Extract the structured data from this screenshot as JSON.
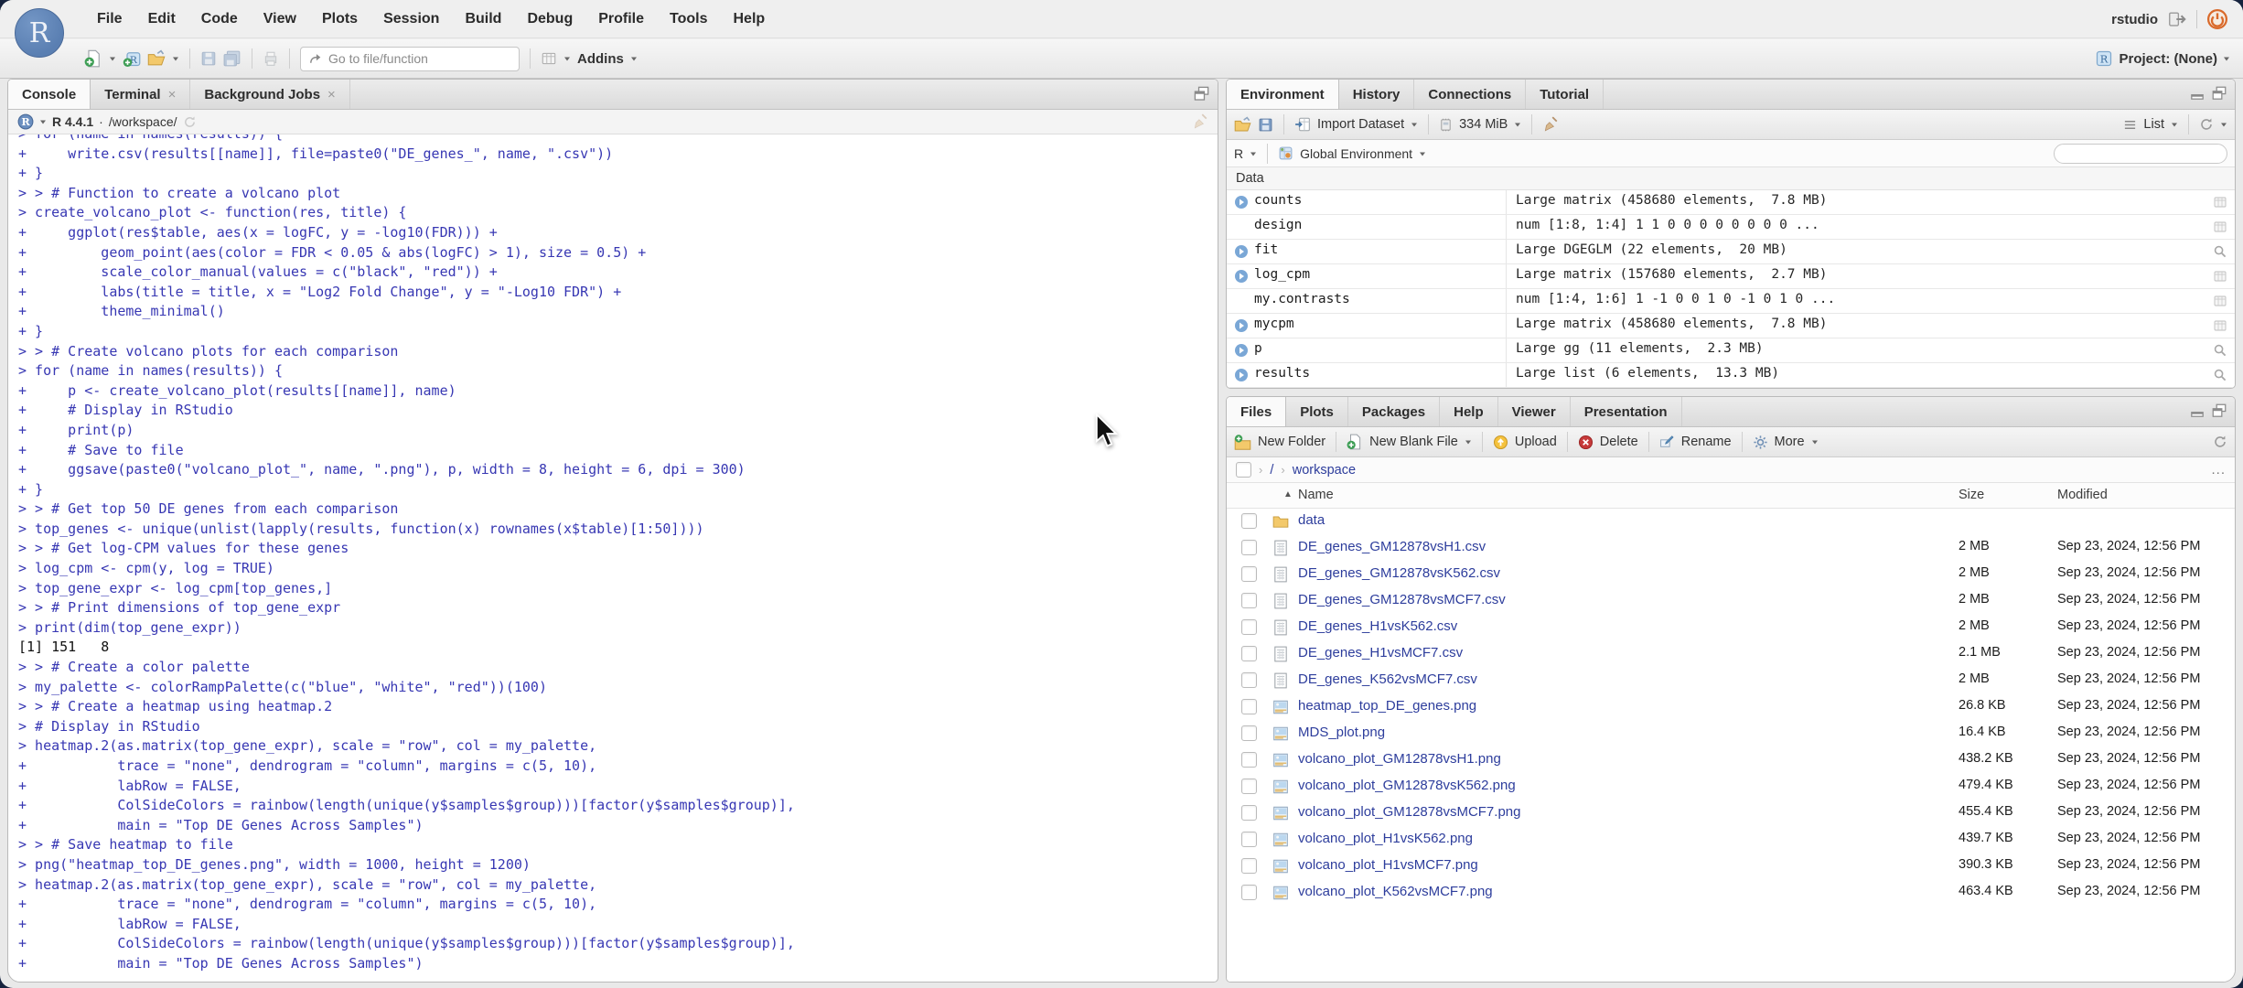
{
  "app": {
    "brand_letter": "R",
    "session_user": "rstudio",
    "project_label": "Project: (None)",
    "menu_items": [
      "File",
      "Edit",
      "Code",
      "View",
      "Plots",
      "Session",
      "Build",
      "Debug",
      "Profile",
      "Tools",
      "Help"
    ],
    "goto_placeholder": "Go to file/function",
    "addins_label": "Addins"
  },
  "console_pane": {
    "tabs": [
      {
        "label": "Console",
        "active": true,
        "closable": false
      },
      {
        "label": "Terminal",
        "active": false,
        "closable": true
      },
      {
        "label": "Background Jobs",
        "active": false,
        "closable": true
      }
    ],
    "r_version": "R 4.4.1",
    "dot": "·",
    "working_dir": "/workspace/",
    "lines": [
      {
        "kind": "input",
        "text": "> for (name in names(results)) {"
      },
      {
        "kind": "input",
        "text": "+     write.csv(results[[name]], file=paste0(\"DE_genes_\", name, \".csv\"))"
      },
      {
        "kind": "input",
        "text": "+ }"
      },
      {
        "kind": "input",
        "text": "> > # Function to create a volcano plot"
      },
      {
        "kind": "input",
        "text": "> create_volcano_plot <- function(res, title) {"
      },
      {
        "kind": "input",
        "text": "+     ggplot(res$table, aes(x = logFC, y = -log10(FDR))) +"
      },
      {
        "kind": "input",
        "text": "+         geom_point(aes(color = FDR < 0.05 & abs(logFC) > 1), size = 0.5) +"
      },
      {
        "kind": "input",
        "text": "+         scale_color_manual(values = c(\"black\", \"red\")) +"
      },
      {
        "kind": "input",
        "text": "+         labs(title = title, x = \"Log2 Fold Change\", y = \"-Log10 FDR\") +"
      },
      {
        "kind": "input",
        "text": "+         theme_minimal()"
      },
      {
        "kind": "input",
        "text": "+ }"
      },
      {
        "kind": "input",
        "text": "> > # Create volcano plots for each comparison"
      },
      {
        "kind": "input",
        "text": "> for (name in names(results)) {"
      },
      {
        "kind": "input",
        "text": "+     p <- create_volcano_plot(results[[name]], name)"
      },
      {
        "kind": "input",
        "text": "+     # Display in RStudio"
      },
      {
        "kind": "input",
        "text": "+     print(p)"
      },
      {
        "kind": "input",
        "text": "+     # Save to file"
      },
      {
        "kind": "input",
        "text": "+     ggsave(paste0(\"volcano_plot_\", name, \".png\"), p, width = 8, height = 6, dpi = 300)"
      },
      {
        "kind": "input",
        "text": "+ }"
      },
      {
        "kind": "input",
        "text": "> > # Get top 50 DE genes from each comparison"
      },
      {
        "kind": "input",
        "text": "> top_genes <- unique(unlist(lapply(results, function(x) rownames(x$table)[1:50])))"
      },
      {
        "kind": "input",
        "text": "> > # Get log-CPM values for these genes"
      },
      {
        "kind": "input",
        "text": "> log_cpm <- cpm(y, log = TRUE)"
      },
      {
        "kind": "input",
        "text": "> top_gene_expr <- log_cpm[top_genes,]"
      },
      {
        "kind": "input",
        "text": "> > # Print dimensions of top_gene_expr"
      },
      {
        "kind": "input",
        "text": "> print(dim(top_gene_expr))"
      },
      {
        "kind": "output",
        "text": "[1] 151   8"
      },
      {
        "kind": "input",
        "text": "> > # Create a color palette"
      },
      {
        "kind": "input",
        "text": "> my_palette <- colorRampPalette(c(\"blue\", \"white\", \"red\"))(100)"
      },
      {
        "kind": "input",
        "text": "> > # Create a heatmap using heatmap.2"
      },
      {
        "kind": "input",
        "text": "> # Display in RStudio"
      },
      {
        "kind": "input",
        "text": "> heatmap.2(as.matrix(top_gene_expr), scale = \"row\", col = my_palette,"
      },
      {
        "kind": "input",
        "text": "+           trace = \"none\", dendrogram = \"column\", margins = c(5, 10),"
      },
      {
        "kind": "input",
        "text": "+           labRow = FALSE,"
      },
      {
        "kind": "input",
        "text": "+           ColSideColors = rainbow(length(unique(y$samples$group)))[factor(y$samples$group)],"
      },
      {
        "kind": "input",
        "text": "+           main = \"Top DE Genes Across Samples\")"
      },
      {
        "kind": "input",
        "text": "> > # Save heatmap to file"
      },
      {
        "kind": "input",
        "text": "> png(\"heatmap_top_DE_genes.png\", width = 1000, height = 1200)"
      },
      {
        "kind": "input",
        "text": "> heatmap.2(as.matrix(top_gene_expr), scale = \"row\", col = my_palette,"
      },
      {
        "kind": "input",
        "text": "+           trace = \"none\", dendrogram = \"column\", margins = c(5, 10),"
      },
      {
        "kind": "input",
        "text": "+           labRow = FALSE,"
      },
      {
        "kind": "input",
        "text": "+           ColSideColors = rainbow(length(unique(y$samples$group)))[factor(y$samples$group)],"
      },
      {
        "kind": "input",
        "text": "+           main = \"Top DE Genes Across Samples\")"
      }
    ]
  },
  "environment_pane": {
    "tabs": [
      {
        "label": "Environment",
        "active": true
      },
      {
        "label": "History",
        "active": false
      },
      {
        "label": "Connections",
        "active": false
      },
      {
        "label": "Tutorial",
        "active": false
      }
    ],
    "import_label": "Import Dataset",
    "memory_label": "334 MiB",
    "list_label": "List",
    "language_label": "R",
    "scope_label": "Global Environment",
    "section_label": "Data",
    "objects": [
      {
        "name": "counts",
        "value": "Large matrix (458680 elements,  7.8 MB)",
        "expandable": true,
        "action": "table"
      },
      {
        "name": "design",
        "value": "num [1:8, 1:4] 1 1 0 0 0 0 0 0 0 0 ...",
        "expandable": false,
        "action": "table"
      },
      {
        "name": "fit",
        "value": "Large DGEGLM (22 elements,  20 MB)",
        "expandable": true,
        "action": "magnifier"
      },
      {
        "name": "log_cpm",
        "value": "Large matrix (157680 elements,  2.7 MB)",
        "expandable": true,
        "action": "table"
      },
      {
        "name": "my.contrasts",
        "value": "num [1:4, 1:6] 1 -1 0 0 1 0 -1 0 1 0 ...",
        "expandable": false,
        "action": "table"
      },
      {
        "name": "mycpm",
        "value": "Large matrix (458680 elements,  7.8 MB)",
        "expandable": true,
        "action": "table"
      },
      {
        "name": "p",
        "value": "Large gg (11 elements,  2.3 MB)",
        "expandable": true,
        "action": "magnifier"
      },
      {
        "name": "results",
        "value": "Large list (6 elements,  13.3 MB)",
        "expandable": true,
        "action": "magnifier"
      }
    ]
  },
  "files_pane": {
    "tabs": [
      {
        "label": "Files",
        "active": true
      },
      {
        "label": "Plots",
        "active": false
      },
      {
        "label": "Packages",
        "active": false
      },
      {
        "label": "Help",
        "active": false
      },
      {
        "label": "Viewer",
        "active": false
      },
      {
        "label": "Presentation",
        "active": false
      }
    ],
    "toolbar": {
      "new_folder": "New Folder",
      "new_blank_file": "New Blank File",
      "upload": "Upload",
      "delete": "Delete",
      "rename": "Rename",
      "more": "More"
    },
    "breadcrumb": {
      "root": "/",
      "folder": "workspace",
      "more": "..."
    },
    "columns": {
      "name": "Name",
      "size": "Size",
      "modified": "Modified"
    },
    "files": [
      {
        "name": "data",
        "type": "folder",
        "size": "",
        "modified": ""
      },
      {
        "name": "DE_genes_GM12878vsH1.csv",
        "type": "csv",
        "size": "2 MB",
        "modified": "Sep 23, 2024, 12:56 PM"
      },
      {
        "name": "DE_genes_GM12878vsK562.csv",
        "type": "csv",
        "size": "2 MB",
        "modified": "Sep 23, 2024, 12:56 PM"
      },
      {
        "name": "DE_genes_GM12878vsMCF7.csv",
        "type": "csv",
        "size": "2 MB",
        "modified": "Sep 23, 2024, 12:56 PM"
      },
      {
        "name": "DE_genes_H1vsK562.csv",
        "type": "csv",
        "size": "2 MB",
        "modified": "Sep 23, 2024, 12:56 PM"
      },
      {
        "name": "DE_genes_H1vsMCF7.csv",
        "type": "csv",
        "size": "2.1 MB",
        "modified": "Sep 23, 2024, 12:56 PM"
      },
      {
        "name": "DE_genes_K562vsMCF7.csv",
        "type": "csv",
        "size": "2 MB",
        "modified": "Sep 23, 2024, 12:56 PM"
      },
      {
        "name": "heatmap_top_DE_genes.png",
        "type": "image",
        "size": "26.8 KB",
        "modified": "Sep 23, 2024, 12:56 PM"
      },
      {
        "name": "MDS_plot.png",
        "type": "image",
        "size": "16.4 KB",
        "modified": "Sep 23, 2024, 12:56 PM"
      },
      {
        "name": "volcano_plot_GM12878vsH1.png",
        "type": "image",
        "size": "438.2 KB",
        "modified": "Sep 23, 2024, 12:56 PM"
      },
      {
        "name": "volcano_plot_GM12878vsK562.png",
        "type": "image",
        "size": "479.4 KB",
        "modified": "Sep 23, 2024, 12:56 PM"
      },
      {
        "name": "volcano_plot_GM12878vsMCF7.png",
        "type": "image",
        "size": "455.4 KB",
        "modified": "Sep 23, 2024, 12:56 PM"
      },
      {
        "name": "volcano_plot_H1vsK562.png",
        "type": "image",
        "size": "439.7 KB",
        "modified": "Sep 23, 2024, 12:56 PM"
      },
      {
        "name": "volcano_plot_H1vsMCF7.png",
        "type": "image",
        "size": "390.3 KB",
        "modified": "Sep 23, 2024, 12:56 PM"
      },
      {
        "name": "volcano_plot_K562vsMCF7.png",
        "type": "image",
        "size": "463.4 KB",
        "modified": "Sep 23, 2024, 12:56 PM"
      }
    ]
  },
  "colors": {
    "console_input": "#3737b3",
    "console_output": "#111111",
    "file_link": "#2d3d9c",
    "power_orange": "#d96a2b",
    "logo_blue": "#5a7fb2"
  }
}
